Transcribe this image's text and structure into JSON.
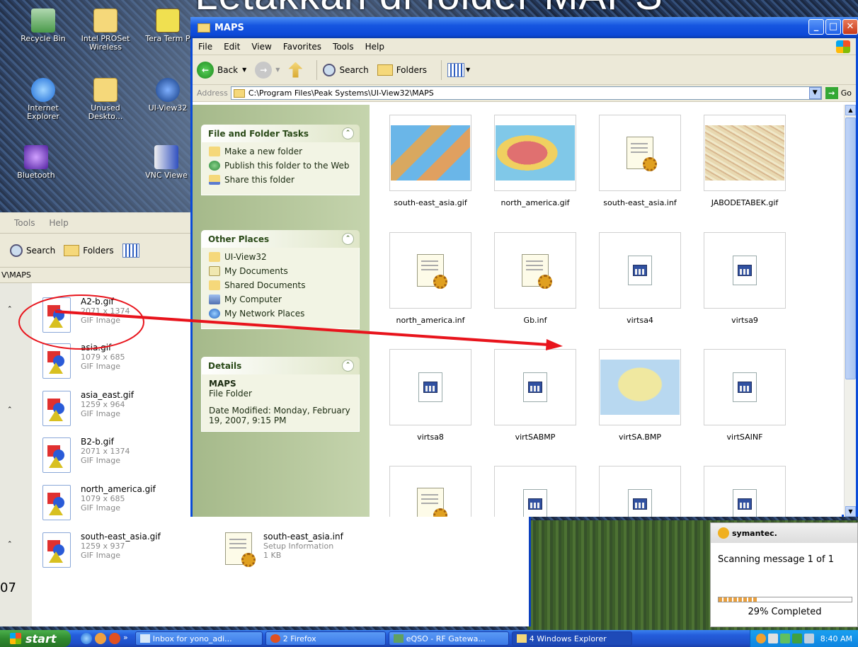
{
  "slide": {
    "title": "Letakkan di folder MAPS"
  },
  "desktop": {
    "icons": [
      {
        "label": "Recycle Bin"
      },
      {
        "label": "Intel PROSet Wireless"
      },
      {
        "label": "Tera Term P"
      },
      {
        "label": "Internet Explorer"
      },
      {
        "label": "Unused Deskto..."
      },
      {
        "label": "UI-View32"
      },
      {
        "label": "Bluetooth"
      },
      {
        "label": "VNC Viewe"
      }
    ],
    "stray_text": "07"
  },
  "back_window": {
    "menu": [
      "Tools",
      "Help"
    ],
    "toolbar": {
      "search": "Search",
      "folders": "Folders"
    },
    "address": "V\\MAPS",
    "files": [
      {
        "name": "A2-b.gif",
        "dims": "2071 x 1374",
        "type": "GIF Image"
      },
      {
        "name": "asia.gif",
        "dims": "1079 x 685",
        "type": "GIF Image"
      },
      {
        "name": "asia_east.gif",
        "dims": "1259 x 964",
        "type": "GIF Image"
      },
      {
        "name": "B2-b.gif",
        "dims": "2071 x 1374",
        "type": "GIF Image"
      },
      {
        "name": "north_america.gif",
        "dims": "1079 x 685",
        "type": "GIF Image"
      },
      {
        "name": "south-east_asia.gif",
        "dims": "1259 x 937",
        "type": "GIF Image"
      }
    ],
    "inf_file": {
      "name": "south-east_asia.inf",
      "type": "Setup Information",
      "size": "1 KB"
    }
  },
  "main_window": {
    "title": "MAPS",
    "menu": [
      "File",
      "Edit",
      "View",
      "Favorites",
      "Tools",
      "Help"
    ],
    "toolbar": {
      "back": "Back",
      "search": "Search",
      "folders": "Folders"
    },
    "address_label": "Address",
    "address": "C:\\Program Files\\Peak Systems\\UI-View32\\MAPS",
    "go": "Go",
    "tasks": {
      "title": "File and Folder Tasks",
      "items": [
        "Make a new folder",
        "Publish this folder to the Web",
        "Share this folder"
      ]
    },
    "places": {
      "title": "Other Places",
      "items": [
        "UI-View32",
        "My Documents",
        "Shared Documents",
        "My Computer",
        "My Network Places"
      ]
    },
    "details": {
      "title": "Details",
      "name": "MAPS",
      "kind": "File Folder",
      "modified": "Date Modified: Monday, February 19, 2007, 9:15 PM"
    },
    "files": [
      {
        "name": "south-east_asia.gif",
        "kind": "map-sea"
      },
      {
        "name": "north_america.gif",
        "kind": "map-na"
      },
      {
        "name": "south-east_asia.inf",
        "kind": "inf"
      },
      {
        "name": "JABODETABEK.gif",
        "kind": "map-city"
      },
      {
        "name": "north_america.inf",
        "kind": "inf"
      },
      {
        "name": "Gb.inf",
        "kind": "inf"
      },
      {
        "name": "virtsa4",
        "kind": "bmp"
      },
      {
        "name": "virtsa9",
        "kind": "bmp"
      },
      {
        "name": "virtsa8",
        "kind": "bmp"
      },
      {
        "name": "virtSABMP",
        "kind": "bmp"
      },
      {
        "name": "virtSA.BMP",
        "kind": "map-na2"
      },
      {
        "name": "virtSAINF",
        "kind": "bmp"
      }
    ]
  },
  "symantec": {
    "brand": "symantec.",
    "message": "Scanning message 1 of 1",
    "progress": 0.29,
    "progress_text": "29% Completed"
  },
  "taskbar": {
    "start": "start",
    "tasks": [
      "Inbox for yono_adi...",
      "2 Firefox",
      "eQSO - RF Gatewa...",
      "4 Windows Explorer"
    ],
    "clock": "8:40 AM"
  },
  "colors": {
    "annotation": "#e8141c",
    "title_blue": "#0c48d8"
  }
}
